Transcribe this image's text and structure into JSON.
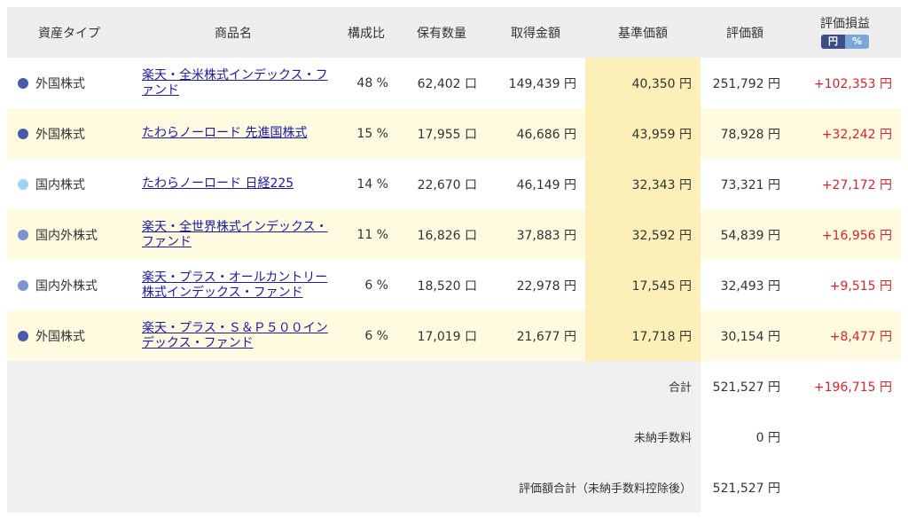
{
  "header": {
    "asset_type": "資産タイプ",
    "name": "商品名",
    "ratio": "構成比",
    "quantity": "保有数量",
    "cost": "取得金額",
    "base_price": "基準価額",
    "value": "評価額",
    "pl": "評価損益",
    "toggle_yen": "円",
    "toggle_pct": "%"
  },
  "rows": [
    {
      "type": "外国株式",
      "dot": "#4a5aa8",
      "name": "楽天・全米株式インデックス・ファンド",
      "ratio": "48 %",
      "quantity": "62,402 口",
      "cost": "149,439 円",
      "base": "40,350 円",
      "value": "251,792 円",
      "pl": "+102,353 円"
    },
    {
      "type": "外国株式",
      "dot": "#4a5aa8",
      "name": "たわらノーロード 先進国株式",
      "ratio": "15 %",
      "quantity": "17,955 口",
      "cost": "46,686 円",
      "base": "43,959 円",
      "value": "78,928 円",
      "pl": "+32,242 円"
    },
    {
      "type": "国内株式",
      "dot": "#9fd0f5",
      "name": "たわらノーロード 日経225",
      "ratio": "14 %",
      "quantity": "22,670 口",
      "cost": "46,149 円",
      "base": "32,343 円",
      "value": "73,321 円",
      "pl": "+27,172 円"
    },
    {
      "type": "国内外株式",
      "dot": "#7e94cf",
      "name": "楽天・全世界株式インデックス・ファンド",
      "ratio": "11 %",
      "quantity": "16,826 口",
      "cost": "37,883 円",
      "base": "32,592 円",
      "value": "54,839 円",
      "pl": "+16,956 円"
    },
    {
      "type": "国内外株式",
      "dot": "#7e94cf",
      "name": "楽天・プラス・オールカントリー株式インデックス・ファンド",
      "ratio": "6 %",
      "quantity": "18,520 口",
      "cost": "22,978 円",
      "base": "17,545 円",
      "value": "32,493 円",
      "pl": "+9,515 円"
    },
    {
      "type": "外国株式",
      "dot": "#4a5aa8",
      "name": "楽天・プラス・Ｓ＆Ｐ５００インデックス・ファンド",
      "ratio": "6 %",
      "quantity": "17,019 口",
      "cost": "21,677 円",
      "base": "17,718 円",
      "value": "30,154 円",
      "pl": "+8,477 円"
    }
  ],
  "totals": {
    "sum_label": "合計",
    "sum_value": "521,527 円",
    "sum_pl": "+196,715 円",
    "fee_label": "未納手数料",
    "fee_value": "0 円",
    "net_label": "評価額合計（未納手数料控除後）",
    "net_value": "521,527 円"
  }
}
